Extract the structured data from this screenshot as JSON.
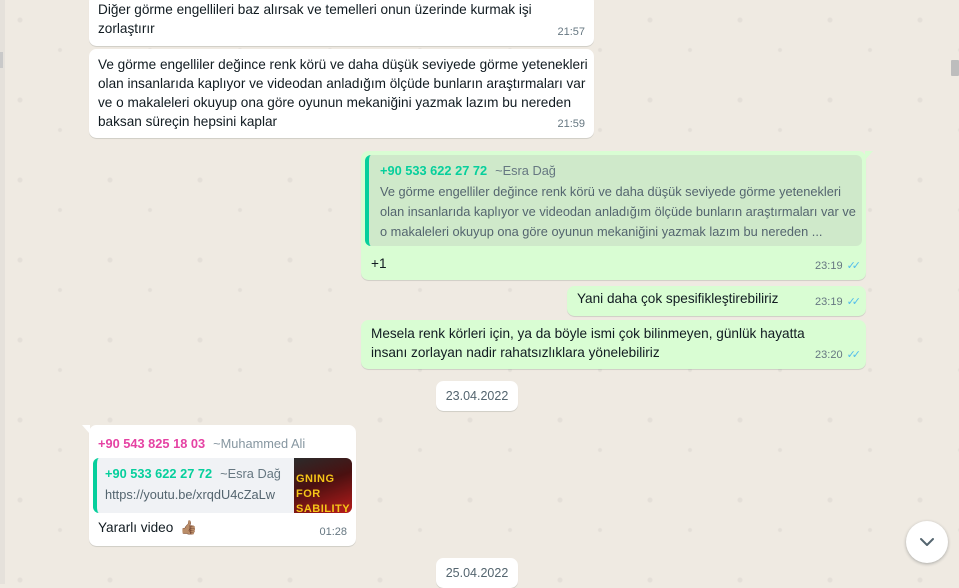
{
  "messages": {
    "m1": {
      "text": "Diğer görme engellileri baz alırsak ve temelleri onun üzerinde kurmak işi zorlaştırır",
      "time": "21:57"
    },
    "m2": {
      "text": "Ve görme engelliler değince renk körü ve daha düşük seviyede görme yetenekleri olan insanlarıda kaplıyor ve videodan anladığım ölçüde bunların araştırmaları var ve o makaleleri okuyup ona göre oyunun mekaniğini yazmak lazım bu nereden baksan süreçin hepsini kaplar",
      "time": "21:59"
    },
    "m3": {
      "quote_sender": "+90 533 622 27 72",
      "quote_alias": "~Esra Dağ",
      "quote_text": "Ve görme engelliler değince renk körü ve daha düşük seviyede görme yetenekleri olan insanlarıda kaplıyor ve videodan anladığım ölçüde bunların araştırmaları var ve o makaleleri okuyup ona göre oyunun mekaniğini yazmak lazım bu nereden ...",
      "text": "+1",
      "time": "23:19"
    },
    "m4": {
      "text": "Yani daha çok spesifikleştirebiliriz",
      "time": "23:19"
    },
    "m5": {
      "text": "Mesela renk körleri için, ya da böyle ismi çok bilinmeyen, günlük hayatta insanı zorlayan nadir rahatsızlıklara yönelebiliriz",
      "time": "23:20"
    },
    "m6": {
      "sender": "+90 543 825 18 03",
      "alias": "~Muhammed Ali",
      "quote_sender": "+90 533 622 27 72",
      "quote_alias": "~Esra Dağ",
      "quote_text": "https://youtu.be/xrqdU4cZaLw",
      "thumb_text": "GNING FOR SABILITY",
      "text": "Yararlı video",
      "emoji": "👍🏽",
      "time": "01:28"
    }
  },
  "dates": {
    "d1": "23.04.2022",
    "d2": "25.04.2022"
  },
  "ticks": "✓✓",
  "icons": {
    "scroll_down": "chevron-down-icon",
    "read_ticks": "double-check-icon"
  },
  "colors": {
    "outgoing": "#d9fdd3",
    "incoming": "#ffffff",
    "quote_bar": "#06cf9c",
    "sender2": "#e542a3",
    "tick": "#53bdeb"
  }
}
